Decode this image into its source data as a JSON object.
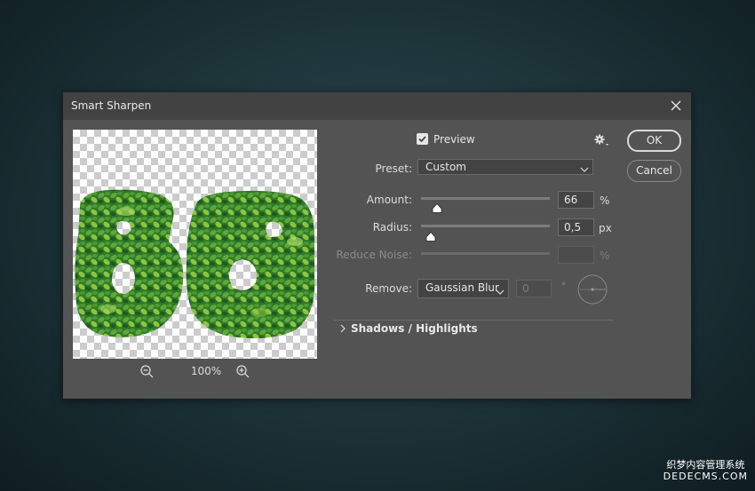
{
  "dialog": {
    "title": "Smart Sharpen",
    "close_icon": "close-icon"
  },
  "preview": {
    "zoom_level": "100%",
    "zoom_out_icon": "zoom-out-icon",
    "zoom_in_icon": "zoom-in-icon"
  },
  "controls": {
    "preview_label": "Preview",
    "preview_checked": true,
    "settings_icon": "gear-icon",
    "preset_label": "Preset:",
    "preset_value": "Custom",
    "amount_label": "Amount:",
    "amount_value": "66",
    "amount_unit": "%",
    "radius_label": "Radius:",
    "radius_value": "0,5",
    "radius_unit": "px",
    "reduce_noise_label": "Reduce Noise:",
    "reduce_noise_value": "",
    "reduce_noise_unit": "%",
    "remove_label": "Remove:",
    "remove_value": "Gaussian Blur",
    "angle_value": "0",
    "angle_unit": "°",
    "section_label": "Shadows / Highlights"
  },
  "buttons": {
    "ok": "OK",
    "cancel": "Cancel"
  },
  "watermark": {
    "line1": "织梦内容管理系统",
    "line2": "DEDECMS.COM"
  },
  "colors": {
    "dialog_bg": "#535353",
    "titlebar_bg": "#424242",
    "leaf_dark": "#2f7a2a",
    "leaf_light": "#8cc63f"
  }
}
